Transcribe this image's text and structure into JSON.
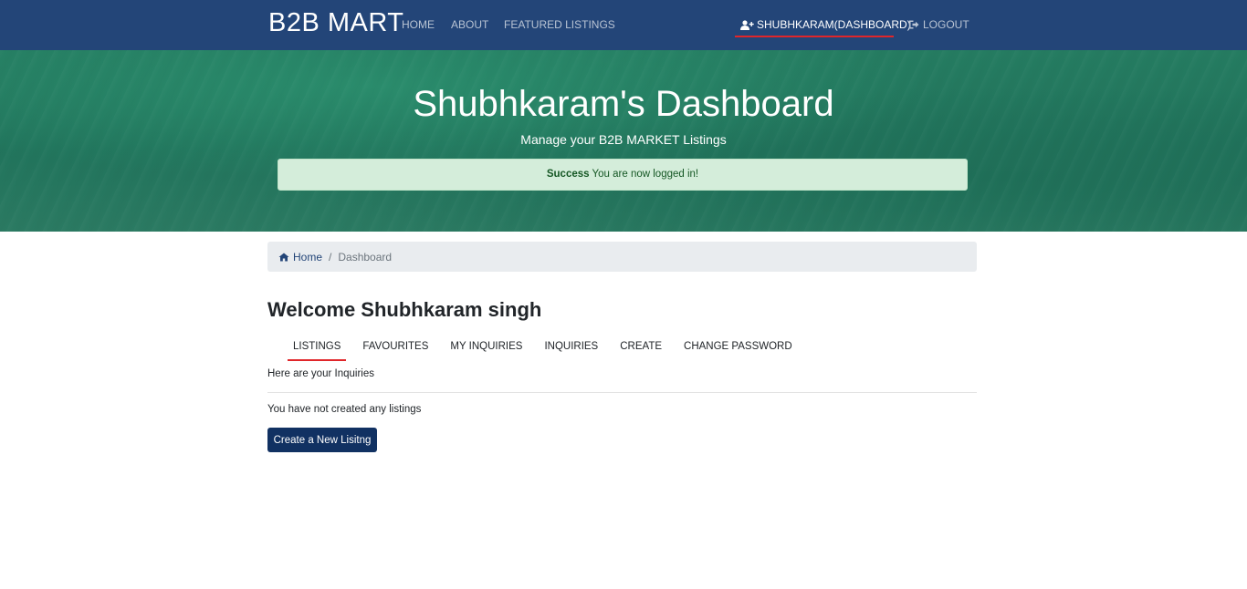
{
  "navbar": {
    "brand": "B2B MART",
    "links": {
      "home": "HOME",
      "about": "ABOUT",
      "featured": "FEATURED LISTINGS",
      "dashboard": "SHUBHKARAM(DASHBOARD)",
      "logout": "LOGOUT"
    },
    "icons": {
      "dashboard": "user-plus-icon",
      "logout": "sign-out-icon"
    }
  },
  "hero": {
    "title": "Shubhkaram's Dashboard",
    "subtitle": "Manage your B2B MARKET Listings",
    "alert": {
      "strong": "Success",
      "message": " You are now logged in!"
    }
  },
  "breadcrumb": {
    "home_icon": "home-icon",
    "home": "Home",
    "separator": "/",
    "current": "Dashboard"
  },
  "main": {
    "welcome": "Welcome Shubhkaram singh",
    "tabs": [
      {
        "label": "LISTINGS",
        "active": true
      },
      {
        "label": "FAVOURITES",
        "active": false
      },
      {
        "label": "MY INQUIRIES",
        "active": false
      },
      {
        "label": "INQUIRIES",
        "active": false
      },
      {
        "label": "CREATE",
        "active": false
      },
      {
        "label": "CHANGE PASSWORD",
        "active": false
      }
    ],
    "inquiries_text": "Here are your Inquiries",
    "empty_text": "You have not created any listings",
    "create_button": "Create a New Lisitng"
  },
  "colors": {
    "navbar": "#234578",
    "accent_underline": "#e0262a",
    "hero": "#257c61",
    "alert_bg": "#d4edda",
    "button": "#113162"
  }
}
